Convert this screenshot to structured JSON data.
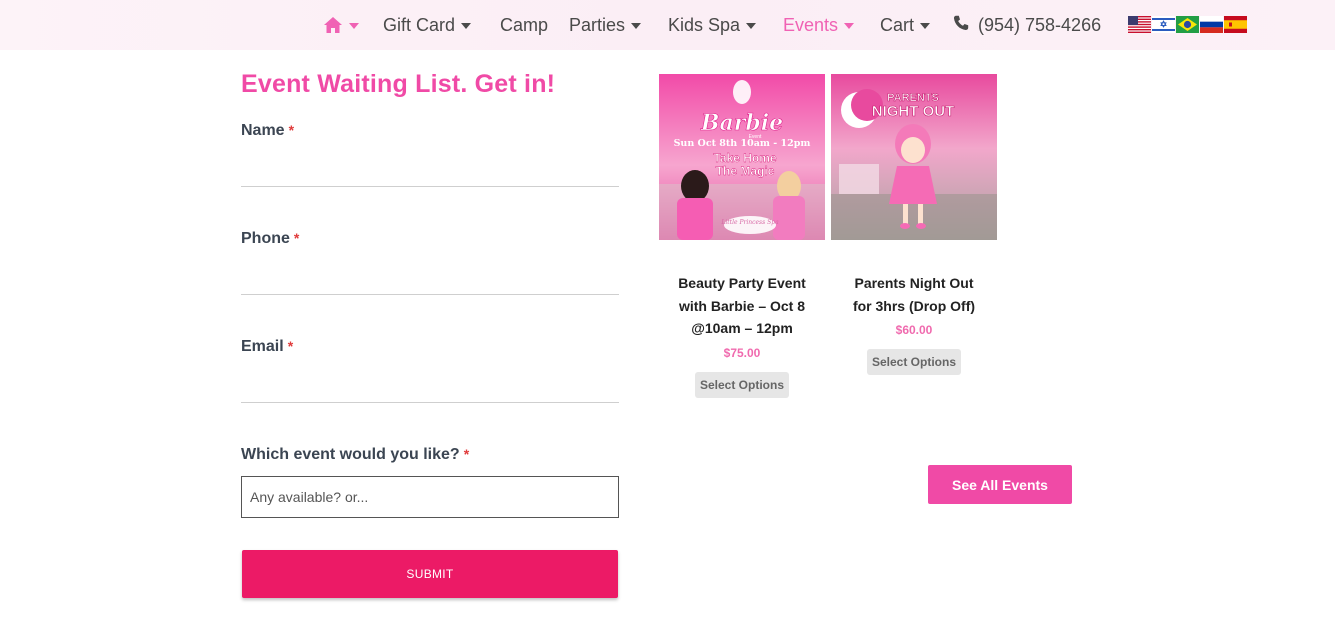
{
  "nav": {
    "items": [
      {
        "label": "Gift Card",
        "dropdown": true
      },
      {
        "label": "Camp",
        "dropdown": false
      },
      {
        "label": "Parties",
        "dropdown": true
      },
      {
        "label": "Kids Spa",
        "dropdown": true
      },
      {
        "label": "Events",
        "dropdown": true,
        "active": true
      },
      {
        "label": "Cart",
        "dropdown": true
      }
    ],
    "phone": "(954) 758-4266",
    "home_icon": "home-icon",
    "phone_icon": "phone-icon",
    "flags": [
      "us-flag-icon",
      "israel-flag-icon",
      "brazil-flag-icon",
      "russia-flag-icon",
      "spain-flag-icon"
    ],
    "accent_color": "#f062b4"
  },
  "form": {
    "title": "Event Waiting List. Get in!",
    "fields": [
      {
        "label": "Name",
        "required_mark": "*",
        "value": ""
      },
      {
        "label": "Phone",
        "required_mark": "*",
        "value": ""
      },
      {
        "label": "Email",
        "required_mark": "*",
        "value": ""
      },
      {
        "label": "Which event would you like?",
        "required_mark": "*",
        "placeholder": "Any available? or..."
      }
    ],
    "submit_label": "SUBMIT",
    "submit_color": "#ec1a66"
  },
  "products": [
    {
      "name": "Beauty Party Event with Barbie – Oct 8 @10am – 12pm",
      "price": "$75.00",
      "button": "Select Options",
      "image_text": {
        "logo": "Barbie",
        "logo_sub": "Event",
        "date": "Sun Oct 8th 10am - 12pm",
        "tagline_1": "Take Home",
        "tagline_2": "The Magic",
        "brand": "Little Princess Spa"
      }
    },
    {
      "name": "Parents Night Out for 3hrs (Drop Off)",
      "price": "$60.00",
      "button": "Select Options",
      "image_text": {
        "line_1": "PARENTS",
        "line_2": "NIGHT OUT"
      }
    }
  ],
  "see_all_label": "See All Events"
}
